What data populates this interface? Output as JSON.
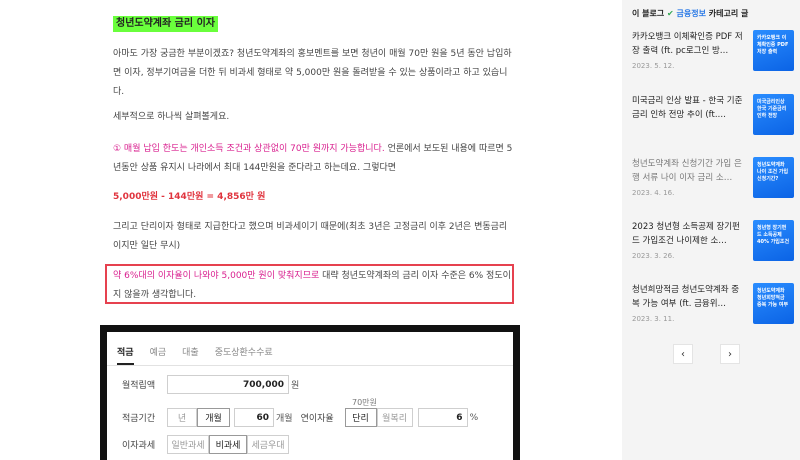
{
  "article": {
    "heading": "청년도약계좌 금리 이자",
    "p1": "아마도 가장 궁금한 부분이겠죠? 청년도약계좌의 홍보멘트를 보면 청년이 매월 70만 원을 5년 동안 납입하면 이자, 정부기여금을 더한 뒤 비과세 형태로 약 5,000만 원을 돌려받을 수 있는 상품이라고 하고 있습니다.",
    "p2": "세부적으로 하나씩 살펴볼게요.",
    "p3_pink": "① 매월 납입 한도는 개인소득 조건과 상관없이 70만 원까지 가능합니다.",
    "p3_rest": " 언론에서 보도된 내용에 따르면 5년동안 상품 유지시 나라에서 최대 144만원을 준다라고 하는데요. 그렇다면",
    "p4": "5,000만원 - 144만원 = 4,856만 원",
    "p5": "그리고 단리이자 형태로 지급한다고 했으며 비과세이기 때문에(최초 3년은 고정금리 이후 2년은 변동금리 이지만 일단 무시)",
    "p6_pink": "약 6%대의 이자율이 나와야 5,000만 원이 맞춰지므로",
    "p6_rest": " 대략 청년도약계좌의 금리 이자 수준은 6% 정도이지 않을까 생각합니다."
  },
  "calculator": {
    "tabs": [
      "적금",
      "예금",
      "대출",
      "중도상환수수료"
    ],
    "monthly_label": "월적립액",
    "monthly_value": "700,000",
    "monthly_unit": "원",
    "monthly_sub": "70만원",
    "period_label": "적금기간",
    "period_opt_year": "년",
    "period_opt_month": "개월",
    "period_value": "60",
    "period_unit": "개월",
    "rate_label": "연이자율",
    "rate_simple": "단리",
    "rate_compound": "월복리",
    "rate_value": "6",
    "rate_unit": "%",
    "tax_label": "이자과세",
    "tax_general": "일반과세",
    "tax_free": "비과세",
    "tax_preferred": "세금우대"
  },
  "sidebar": {
    "head_prefix": "이 블로그",
    "head_check": "✔",
    "head_category": "금융정보",
    "head_suffix": "카테고리 글",
    "posts": [
      {
        "title": "카카오뱅크 이체확인증 PDF 저장 출력 (ft. pc로그인 방…",
        "date": "2023. 5. 12.",
        "thumb": "카카오뱅크 이체확인증 PDF 저장 출력"
      },
      {
        "title": "미국금리 인상 발표 - 한국 기준금리 인하 전망 추이 (ft.…",
        "date": "",
        "thumb": "미국금리인상 한국 기준금리 인하 전망"
      },
      {
        "title": "청년도약계좌 신청기간 가입 은행 서류 나이 이자 금리 소…",
        "date": "2023. 4. 16.",
        "thumb": "청년도약계좌 나이 조건 가입 신청기간?"
      },
      {
        "title": "2023 청년형 소득공제 장기펀드 가입조건 나이제한 소…",
        "date": "2023. 3. 26.",
        "thumb": "청년형 장기펀드 소득공제 40% 가입조건"
      },
      {
        "title": "청년희망적금 청년도약계좌 중복 가능 여부 (ft. 금융위…",
        "date": "2023. 3. 11.",
        "thumb": "청년도약계좌 청년희망적금 중복 가능 여부"
      }
    ],
    "prev": "‹",
    "next": "›"
  }
}
